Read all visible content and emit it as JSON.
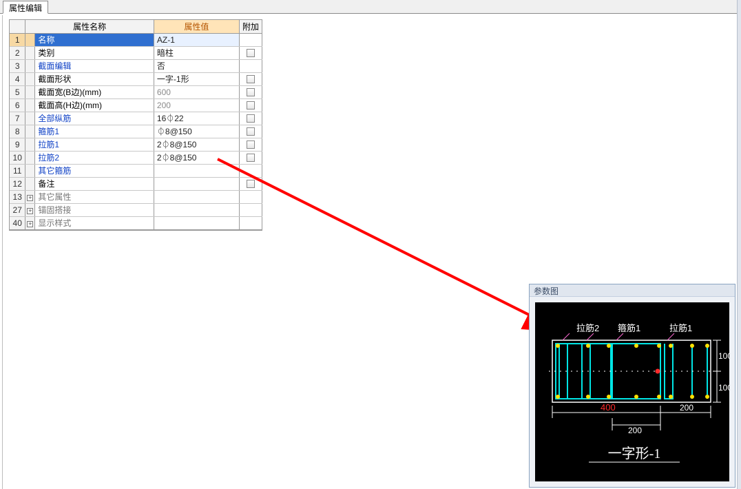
{
  "tab_label": "属性编辑",
  "columns": {
    "name": "属性名称",
    "value": "属性值",
    "extra": "附加"
  },
  "rows": [
    {
      "idx": "1",
      "name": "名称",
      "value": "AZ-1",
      "link": false,
      "dim": false,
      "cb": false,
      "sel": true
    },
    {
      "idx": "2",
      "name": "类别",
      "value": "暗柱",
      "link": false,
      "dim": false,
      "cb": true
    },
    {
      "idx": "3",
      "name": "截面编辑",
      "value": "否",
      "link": true,
      "dim": false,
      "cb": false
    },
    {
      "idx": "4",
      "name": "截面形状",
      "value": "一字-1形",
      "link": false,
      "dim": false,
      "cb": true
    },
    {
      "idx": "5",
      "name": "截面宽(B边)(mm)",
      "value": "600",
      "link": false,
      "dim": true,
      "cb": true
    },
    {
      "idx": "6",
      "name": "截面高(H边)(mm)",
      "value": "200",
      "link": false,
      "dim": true,
      "cb": true
    },
    {
      "idx": "7",
      "name": "全部纵筋",
      "value": "16⏀22",
      "link": true,
      "dim": false,
      "cb": true
    },
    {
      "idx": "8",
      "name": "箍筋1",
      "value": "⏀8@150",
      "link": true,
      "dim": false,
      "cb": true
    },
    {
      "idx": "9",
      "name": "拉筋1",
      "value": "2⏀8@150",
      "link": true,
      "dim": false,
      "cb": true
    },
    {
      "idx": "10",
      "name": "拉筋2",
      "value": "2⏀8@150",
      "link": true,
      "dim": false,
      "cb": true
    },
    {
      "idx": "11",
      "name": "其它箍筋",
      "value": "",
      "link": true,
      "dim": false,
      "cb": false
    },
    {
      "idx": "12",
      "name": "备注",
      "value": "",
      "link": false,
      "dim": false,
      "cb": true
    },
    {
      "idx": "13",
      "name": "其它属性",
      "value": "",
      "group": true,
      "exp": true
    },
    {
      "idx": "27",
      "name": "锚固搭接",
      "value": "",
      "group": true,
      "exp": true
    },
    {
      "idx": "40",
      "name": "显示样式",
      "value": "",
      "group": true,
      "exp": true
    }
  ],
  "panel_title": "参数图",
  "diagram": {
    "labels": {
      "lajin2": "拉筋2",
      "gujin1": "箍筋1",
      "lajin1": "拉筋1"
    },
    "dims": {
      "h1": "100",
      "h2": "100",
      "w_total": "400",
      "w_right": "200",
      "w_mid": "200"
    },
    "caption": "一字形-1"
  }
}
